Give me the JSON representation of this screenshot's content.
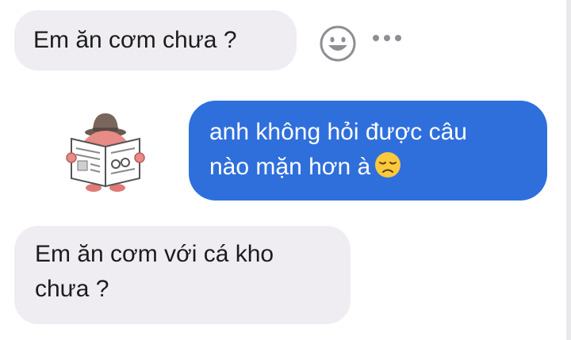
{
  "conversation": {
    "messages": [
      {
        "sender": "other",
        "text": "Em ăn cơm chưa ?"
      },
      {
        "sender": "self",
        "lines": [
          "anh không hỏi được câu",
          "nào mặn hơn à"
        ],
        "emoji": "disappointed-face"
      },
      {
        "sender": "other",
        "lines": [
          "Em ăn cơm với cá kho",
          "chưa ?"
        ]
      }
    ],
    "sticker": "reading-newspaper-sticker"
  },
  "colors": {
    "incoming_bubble": "#efedf1",
    "outgoing_bubble": "#2f6fdc",
    "text_dark": "#1c1c1c",
    "text_light": "#ffffff",
    "icon_gray": "#8e8e94"
  },
  "icons": [
    "smiley-react-icon",
    "more-options-icon",
    "disappointed-face-emoji"
  ]
}
